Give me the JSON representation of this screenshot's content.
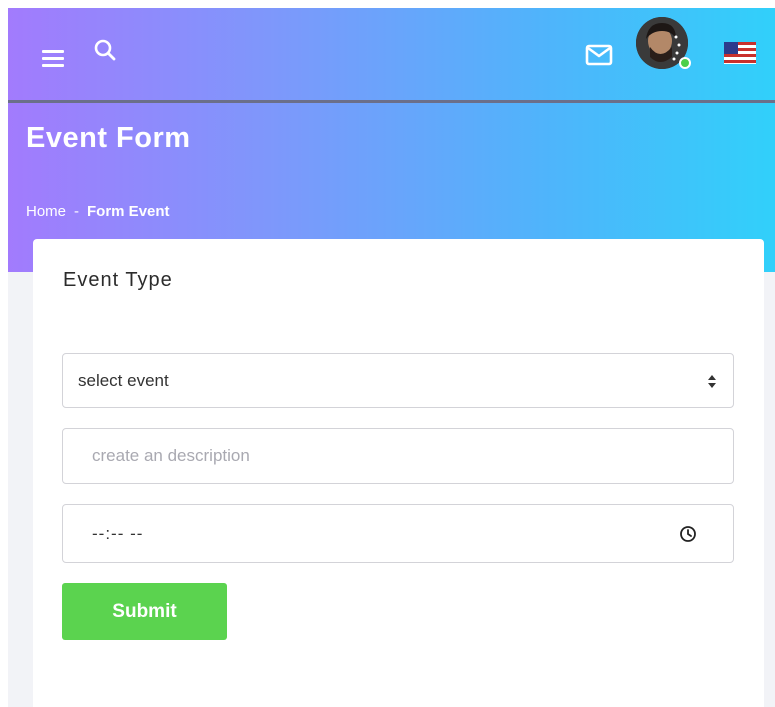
{
  "header": {
    "menu_icon": "menu-icon",
    "search_icon": "search-icon",
    "mail_icon": "mail-icon",
    "avatar_status": "online",
    "language_icon": "us-flag-icon"
  },
  "page": {
    "title": "Event Form",
    "breadcrumb": {
      "home": "Home",
      "separator": "-",
      "current": "Form Event"
    }
  },
  "form": {
    "title": "Event Type",
    "event_select": {
      "value": "select event"
    },
    "description": {
      "placeholder": "create an description",
      "value": ""
    },
    "time": {
      "value": "--:-- --"
    },
    "submit_label": "Submit"
  },
  "colors": {
    "gradient_start": "#a27bfd",
    "gradient_end": "#31d0fa",
    "submit": "#5bd34f",
    "status_online": "#4ccf4a"
  }
}
